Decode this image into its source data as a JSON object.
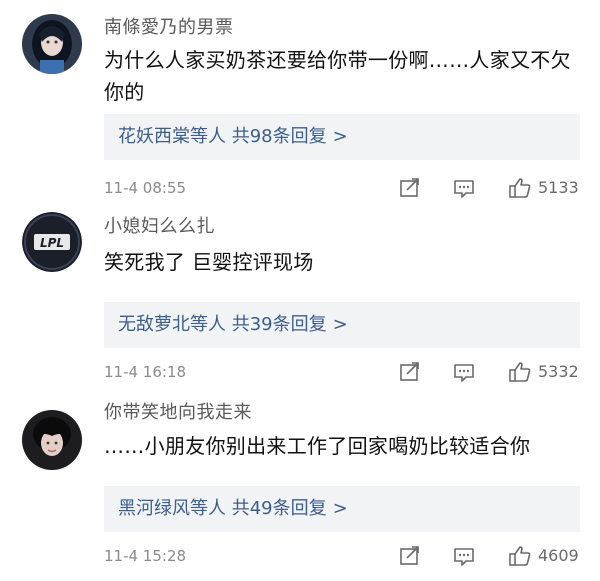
{
  "comments": [
    {
      "username": "南條愛乃的男票",
      "content": "为什么人家买奶茶还要给你带一份啊……人家又不欠你的",
      "replies": {
        "names": "花妖西棠",
        "suffix": "等人",
        "count_text": "共98条回复",
        "chevron": ">"
      },
      "time": "11-4 08:55",
      "likes": "5133",
      "avatar": "photo-portrait"
    },
    {
      "username": "小媳妇么么扎",
      "content": "笑死我了 巨婴控评现场",
      "replies": {
        "names": "无敌萝北",
        "suffix": "等人",
        "count_text": "共39条回复",
        "chevron": ">"
      },
      "time": "11-4 16:18",
      "likes": "5332",
      "avatar": "lpl-logo"
    },
    {
      "username": "你带笑地向我走来",
      "content": "……小朋友你别出来工作了回家喝奶比较适合你",
      "replies": {
        "names": "黑河绿风",
        "suffix": "等人",
        "count_text": "共49条回复",
        "chevron": ">"
      },
      "time": "11-4 15:28",
      "likes": "4609",
      "avatar": "photo-portrait-dark"
    }
  ],
  "lpl_logo_text": "LPL",
  "icons": {
    "share": "share-icon",
    "reply": "comment-icon",
    "like": "thumbs-up-icon"
  },
  "colors": {
    "link": "#3b5e8c",
    "reply_bg": "#f2f3f5",
    "meta": "#8a8a8a"
  }
}
